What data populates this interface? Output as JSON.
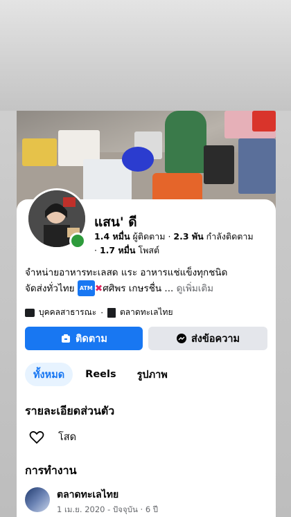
{
  "profile": {
    "name": "แสน' ดี",
    "followers_value": "1.4 หมื่น",
    "followers_label": "ผู้ติดตาม",
    "following_value": "2.3 พัน",
    "following_label": "กำลังติดตาม",
    "posts_value": "1.7 หมื่น",
    "posts_label": "โพสต์",
    "bio_line1": "จำหน่ายอาหารทะเลสด แระ อาหารแช่แข็งทุกชนิด",
    "bio_line2_a": "จัดส่งทั่วไทย",
    "bio_atm": "ATM",
    "bio_line2_b": "ศศิพร เกษรชื่น ...",
    "bio_more": "ดูเพิ่มเติม",
    "meta_public": "บุคคลสาธารณะ",
    "meta_work": "ตลาดทะเลไทย",
    "online_color": "#2e9b3c"
  },
  "actions": {
    "follow_label": "ติดตาม",
    "message_label": "ส่งข้อความ",
    "accent": "#1877f2"
  },
  "tabs": [
    {
      "label": "ทั้งหมด",
      "active": true
    },
    {
      "label": "Reels",
      "active": false
    },
    {
      "label": "รูปภาพ",
      "active": false
    }
  ],
  "details": {
    "title": "รายละเอียดส่วนตัว",
    "relationship_icon": "heart-outline-icon",
    "relationship": "โสด"
  },
  "work": {
    "title": "การทำงาน",
    "company": "ตลาดทะเลไทย",
    "period": "1 เม.ย. 2020 - ปัจจุบัน · 6 ปี"
  }
}
